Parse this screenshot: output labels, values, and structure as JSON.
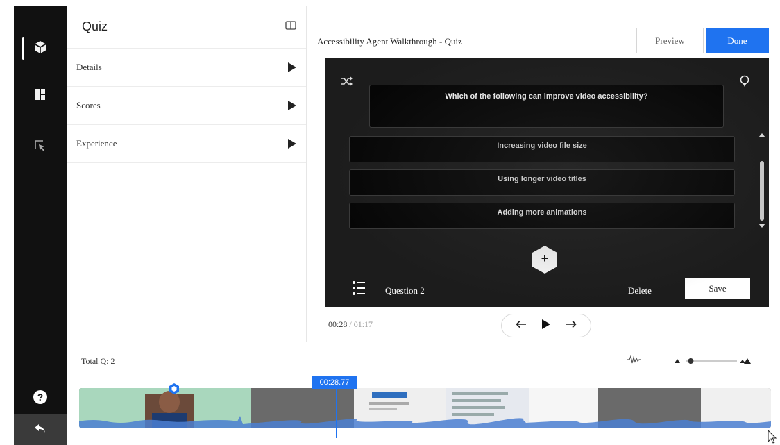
{
  "rail": {
    "items": [
      {
        "name": "quiz-cube-icon",
        "active": true
      },
      {
        "name": "chapters-icon",
        "active": false
      },
      {
        "name": "hotspot-cursor-icon",
        "active": false
      }
    ],
    "help_label": "?"
  },
  "panel": {
    "title": "Quiz",
    "items": [
      {
        "label": "Details"
      },
      {
        "label": "Scores"
      },
      {
        "label": "Experience"
      }
    ]
  },
  "header": {
    "title": "Accessibility Agent Walkthrough - Quiz",
    "preview_label": "Preview",
    "done_label": "Done"
  },
  "quiz": {
    "question": "Which of the following can improve video accessibility?",
    "answers": [
      "Increasing video file size",
      "Using longer video titles",
      "Adding more animations"
    ],
    "add_label": "+",
    "question_label": "Question 2",
    "delete_label": "Delete",
    "save_label": "Save"
  },
  "playback": {
    "current_time": "00:28",
    "separator": " / ",
    "total_time": "01:17"
  },
  "timeline": {
    "total_questions": "Total Q: 2",
    "playhead_time": "00:28.77",
    "zoom_level": 0.1
  },
  "colors": {
    "accent": "#1f73f0",
    "rail": "#111111",
    "player_bg": "#1c1c1c"
  }
}
